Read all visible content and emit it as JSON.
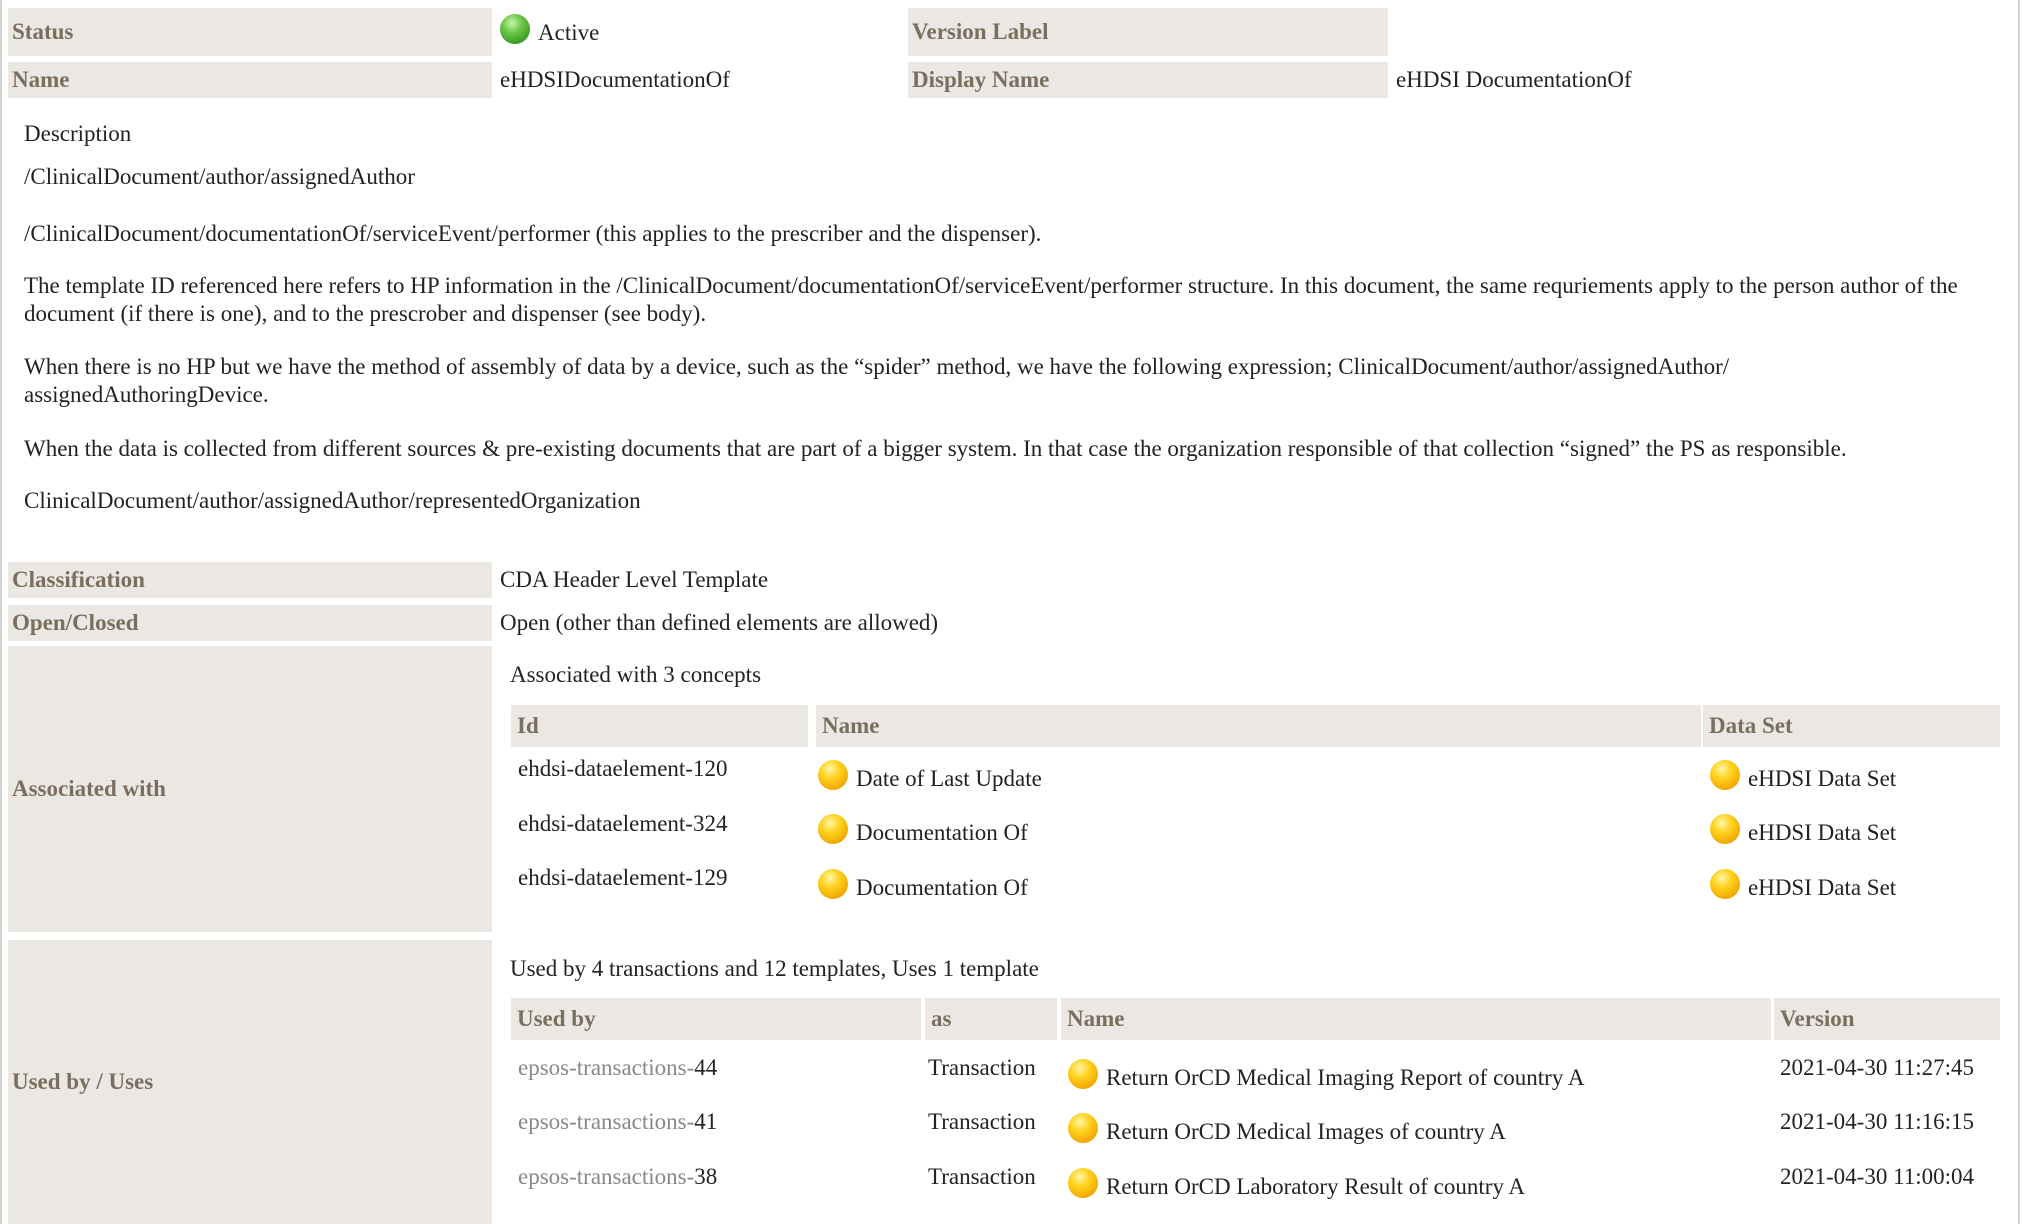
{
  "header": {
    "status_label": "Status",
    "status_value": "Active",
    "status_color": "#4caf2a",
    "version_label": "Version Label",
    "name_label": "Name",
    "name_value": "eHDSIDocumentationOf",
    "display_name_label": "Display Name",
    "display_name_value": "eHDSI DocumentationOf"
  },
  "description": {
    "title": "Description",
    "paragraphs": [
      "/ClinicalDocument/author/assignedAuthor",
      "/ClinicalDocument/documentationOf/serviceEvent/performer (this applies to the prescriber and the dispenser).",
      "The template ID referenced here refers to HP information in the /ClinicalDocument/documentationOf/serviceEvent/performer structure. In this document, the same requriements apply to the person author of the document (if there is one), and to the prescrober and dispenser (see body).",
      "When there is no HP but we have the method of assembly of data by a device, such as the “spider” method, we have the following expression; ClinicalDocument/author/assignedAuthor/ assignedAuthoringDevice.",
      "When the data is collected from different sources & pre-existing documents that are part of a bigger system. In that case the organization responsible of that collection “signed” the PS as responsible.",
      "ClinicalDocument/author/assignedAuthor/representedOrganization"
    ]
  },
  "classification": {
    "label": "Classification",
    "value": "CDA Header Level Template"
  },
  "open_closed": {
    "label": "Open/Closed",
    "value": "Open (other than defined elements are allowed)"
  },
  "associated": {
    "label": "Associated with",
    "summary": "Associated with 3 concepts",
    "columns": {
      "id": "Id",
      "name": "Name",
      "dataset": "Data Set"
    },
    "rows": [
      {
        "id": "ehdsi-dataelement-120",
        "name": "Date of Last Update",
        "dataset": "eHDSI Data Set"
      },
      {
        "id": "ehdsi-dataelement-324",
        "name": "Documentation Of",
        "dataset": "eHDSI Data Set"
      },
      {
        "id": "ehdsi-dataelement-129",
        "name": "Documentation Of",
        "dataset": "eHDSI Data Set"
      }
    ]
  },
  "used_by": {
    "label": "Used by / Uses",
    "summary": "Used by 4 transactions and 12 templates, Uses 1 template",
    "columns": {
      "used_by": "Used by",
      "as": "as",
      "name": "Name",
      "version": "Version"
    },
    "rows": [
      {
        "prefix": "epsos-transactions-",
        "num": "44",
        "as": "Transaction",
        "name": "Return OrCD Medical Imaging Report of country A",
        "version": "2021-04-30 11:27:45"
      },
      {
        "prefix": "epsos-transactions-",
        "num": "41",
        "as": "Transaction",
        "name": "Return OrCD Medical Images of country A",
        "version": "2021-04-30 11:16:15"
      },
      {
        "prefix": "epsos-transactions-",
        "num": "38",
        "as": "Transaction",
        "name": "Return OrCD Laboratory Result of country A",
        "version": "2021-04-30 11:00:04"
      }
    ]
  },
  "colors": {
    "label_bg": "#ebe8e3",
    "label_text": "#7a6e5e",
    "draft_dot": "#f5b800",
    "active_dot": "#4caf2a"
  }
}
